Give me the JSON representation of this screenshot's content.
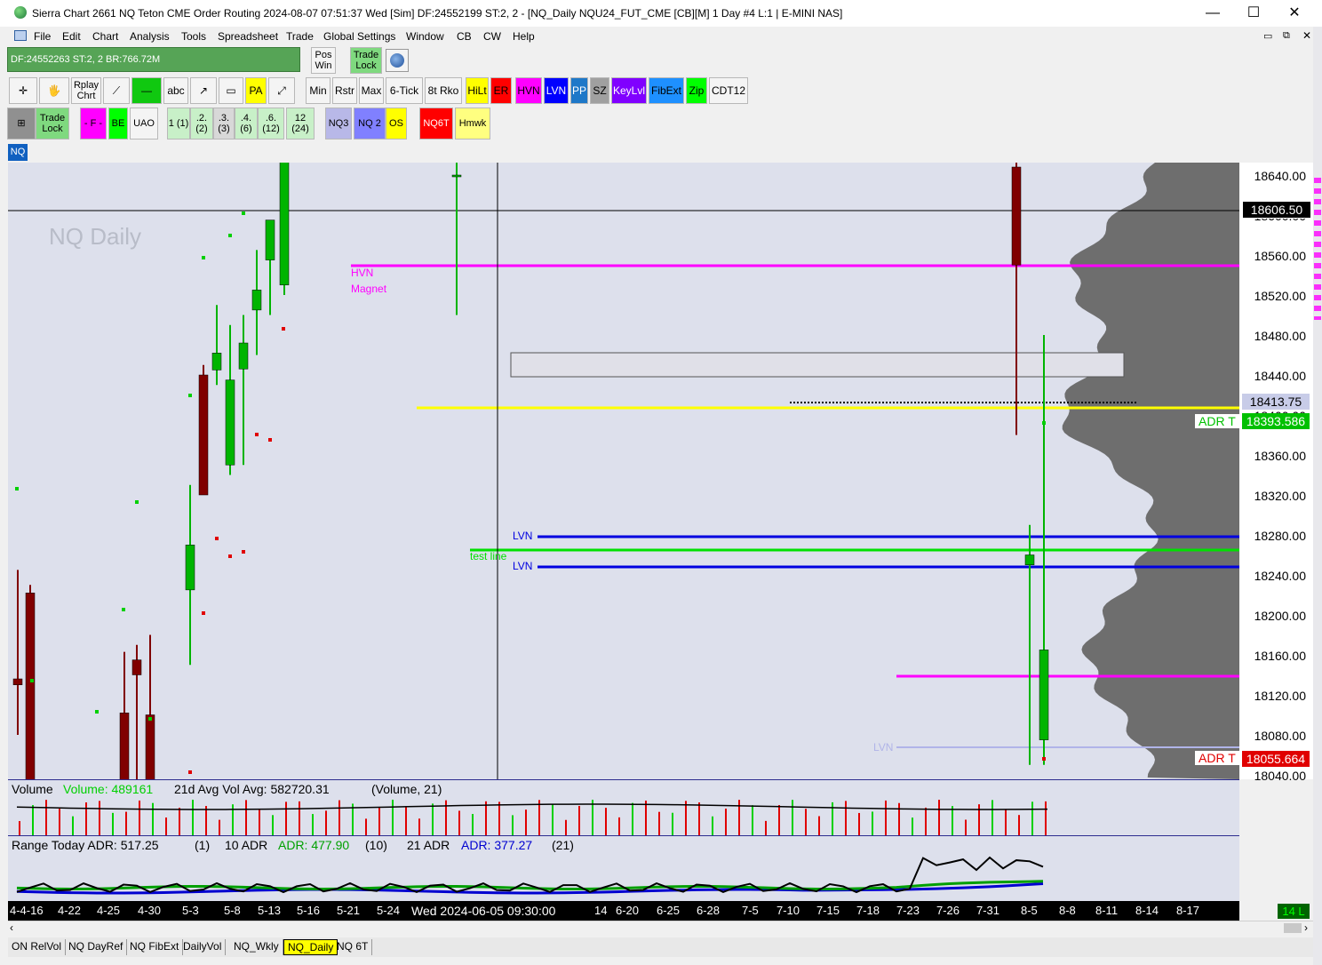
{
  "window": {
    "title": "Sierra Chart 2661 NQ Teton CME Order Routing 2024-08-07  07:51:37 Wed [Sim] DF:24552199  ST:2, 2 - [NQ_Daily NQU24_FUT_CME [CB][M]  1 Day  #4 L:1 | E-MINI NAS]",
    "minimize": "—",
    "maximize": "☐",
    "close": "✕"
  },
  "menu": [
    "File",
    "Edit",
    "Chart",
    "Analysis",
    "Tools",
    "Spreadsheet",
    "Trade",
    "Global Settings",
    "Window",
    "CB",
    "CW",
    "Help"
  ],
  "status": {
    "text": "DF:24552263  ST:2, 2  BR:766.72M",
    "pos_win": "Pos Win",
    "trade_lock": "Trade Lock"
  },
  "toolbar2": [
    {
      "label": "✛",
      "bg": "#f4f4f4"
    },
    {
      "label": "🖐",
      "bg": "#f4f4f4"
    },
    {
      "label": "Rplay Chrt",
      "bg": "#f4f4f4"
    },
    {
      "label": "⟋",
      "bg": "#f4f4f4"
    },
    {
      "label": "—",
      "bg": "#10c810"
    },
    {
      "label": "abc",
      "bg": "#f4f4f4"
    },
    {
      "label": "↗",
      "bg": "#f4f4f4"
    },
    {
      "label": "▭",
      "bg": "#f4f4f4"
    },
    {
      "label": "PA",
      "bg": "#ffff00"
    },
    {
      "label": "⤢",
      "bg": "#f4f4f4"
    },
    {
      "label": "Min",
      "bg": "#f4f4f4"
    },
    {
      "label": "Rstr",
      "bg": "#f4f4f4"
    },
    {
      "label": "Max",
      "bg": "#f4f4f4"
    },
    {
      "label": "6-Tick",
      "bg": "#f4f4f4"
    },
    {
      "label": "8t Rko",
      "bg": "#f4f4f4"
    },
    {
      "label": "HiLt",
      "bg": "#ffff00"
    },
    {
      "label": "ER",
      "bg": "#ff0000"
    },
    {
      "label": "HVN",
      "bg": "#ff00ff"
    },
    {
      "label": "LVN",
      "bg": "#0000ff"
    },
    {
      "label": "PP",
      "bg": "#1e78c8"
    },
    {
      "label": "SZ",
      "bg": "#a0a0a0"
    },
    {
      "label": "KeyLvl",
      "bg": "#8000ff"
    },
    {
      "label": "FibExt",
      "bg": "#1e90ff"
    },
    {
      "label": "Zip",
      "bg": "#00ff00"
    },
    {
      "label": "CDT12",
      "bg": "#f4f4f4"
    }
  ],
  "toolbar3": [
    {
      "label": "⊞",
      "bg": "#909090"
    },
    {
      "label": "Trade Lock",
      "bg": "#7fd97f"
    },
    {
      "label": "- F -",
      "bg": "#ff00ff"
    },
    {
      "label": "BE",
      "bg": "#00ff00"
    },
    {
      "label": "UAO",
      "bg": "#f4f4f4"
    },
    {
      "label": "1 (1)",
      "bg": "#c8f0c8"
    },
    {
      "label": ".2. (2)",
      "bg": "#c8f0c8"
    },
    {
      "label": ".3. (3)",
      "bg": "#d8d8d8"
    },
    {
      "label": ".4. (6)",
      "bg": "#c8f0c8"
    },
    {
      "label": ".6. (12)",
      "bg": "#c8f0c8"
    },
    {
      "label": "12 (24)",
      "bg": "#c8f0c8"
    },
    {
      "label": "NQ3",
      "bg": "#b8b8e8"
    },
    {
      "label": "NQ 2",
      "bg": "#8080ff"
    },
    {
      "label": "OS",
      "bg": "#ffff00"
    },
    {
      "label": "NQ6T",
      "bg": "#ff0000"
    },
    {
      "label": "Hmwk",
      "bg": "#ffff80"
    }
  ],
  "symbol_tag": "NQ",
  "chart": {
    "watermark": "NQ Daily",
    "price_labels": [
      "18640.00",
      "18600.00",
      "18560.00",
      "18520.00",
      "18480.00",
      "18440.00",
      "18400.00",
      "18360.00",
      "18320.00",
      "18280.00",
      "18240.00",
      "18200.00",
      "18160.00",
      "18120.00",
      "18080.00",
      "18040.00"
    ],
    "current_price": "18606.50",
    "marker_1": "18413.75",
    "adr_top_value": "18393.586",
    "adr_bottom_value": "18055.664",
    "adr_label": "ADR T",
    "hvn_text": "HVN",
    "magnet_text": "Magnet",
    "lvn_text": "LVN",
    "test_line_text": "test line",
    "colors": {
      "up": "#00b400",
      "down": "#800000",
      "hvn": "#ff00ff",
      "lvn": "#0000e0",
      "test": "#00e000",
      "yellow": "#ffff00"
    }
  },
  "volume_panel": {
    "title": "Volume",
    "vol_label": "Volume: 489161",
    "avg_label": "21d Avg Vol  Avg: 582720.31",
    "params": "(Volume, 21)"
  },
  "range_panel": {
    "title": "Range Today  ADR: 517.25",
    "p1": "(1)",
    "adr10": "10 ADR",
    "adr10_val": "ADR: 477.90",
    "p10": "(10)",
    "adr21": "21 ADR",
    "adr21_val": "ADR: 377.27",
    "p21": "(21)"
  },
  "date_axis": [
    "4-4-16",
    "4-22",
    "4-25",
    "4-30",
    "5-3",
    "5-8",
    "5-13",
    "5-16",
    "5-21",
    "5-24",
    "Wed 2024-06-05  09:30:00",
    "14",
    "6-20",
    "6-25",
    "6-28",
    "7-5",
    "7-10",
    "7-15",
    "7-18",
    "7-23",
    "7-26",
    "7-31",
    "8-5",
    "8-8",
    "8-11",
    "8-14",
    "8-17"
  ],
  "bar_count": "14 L",
  "tabs": [
    "ON RelVol",
    "NQ DayRef",
    "NQ FibExt",
    "DailyVol",
    "NQ_Wkly",
    "NQ_Daily",
    "NQ 6T"
  ],
  "active_tab": "NQ_Daily"
}
